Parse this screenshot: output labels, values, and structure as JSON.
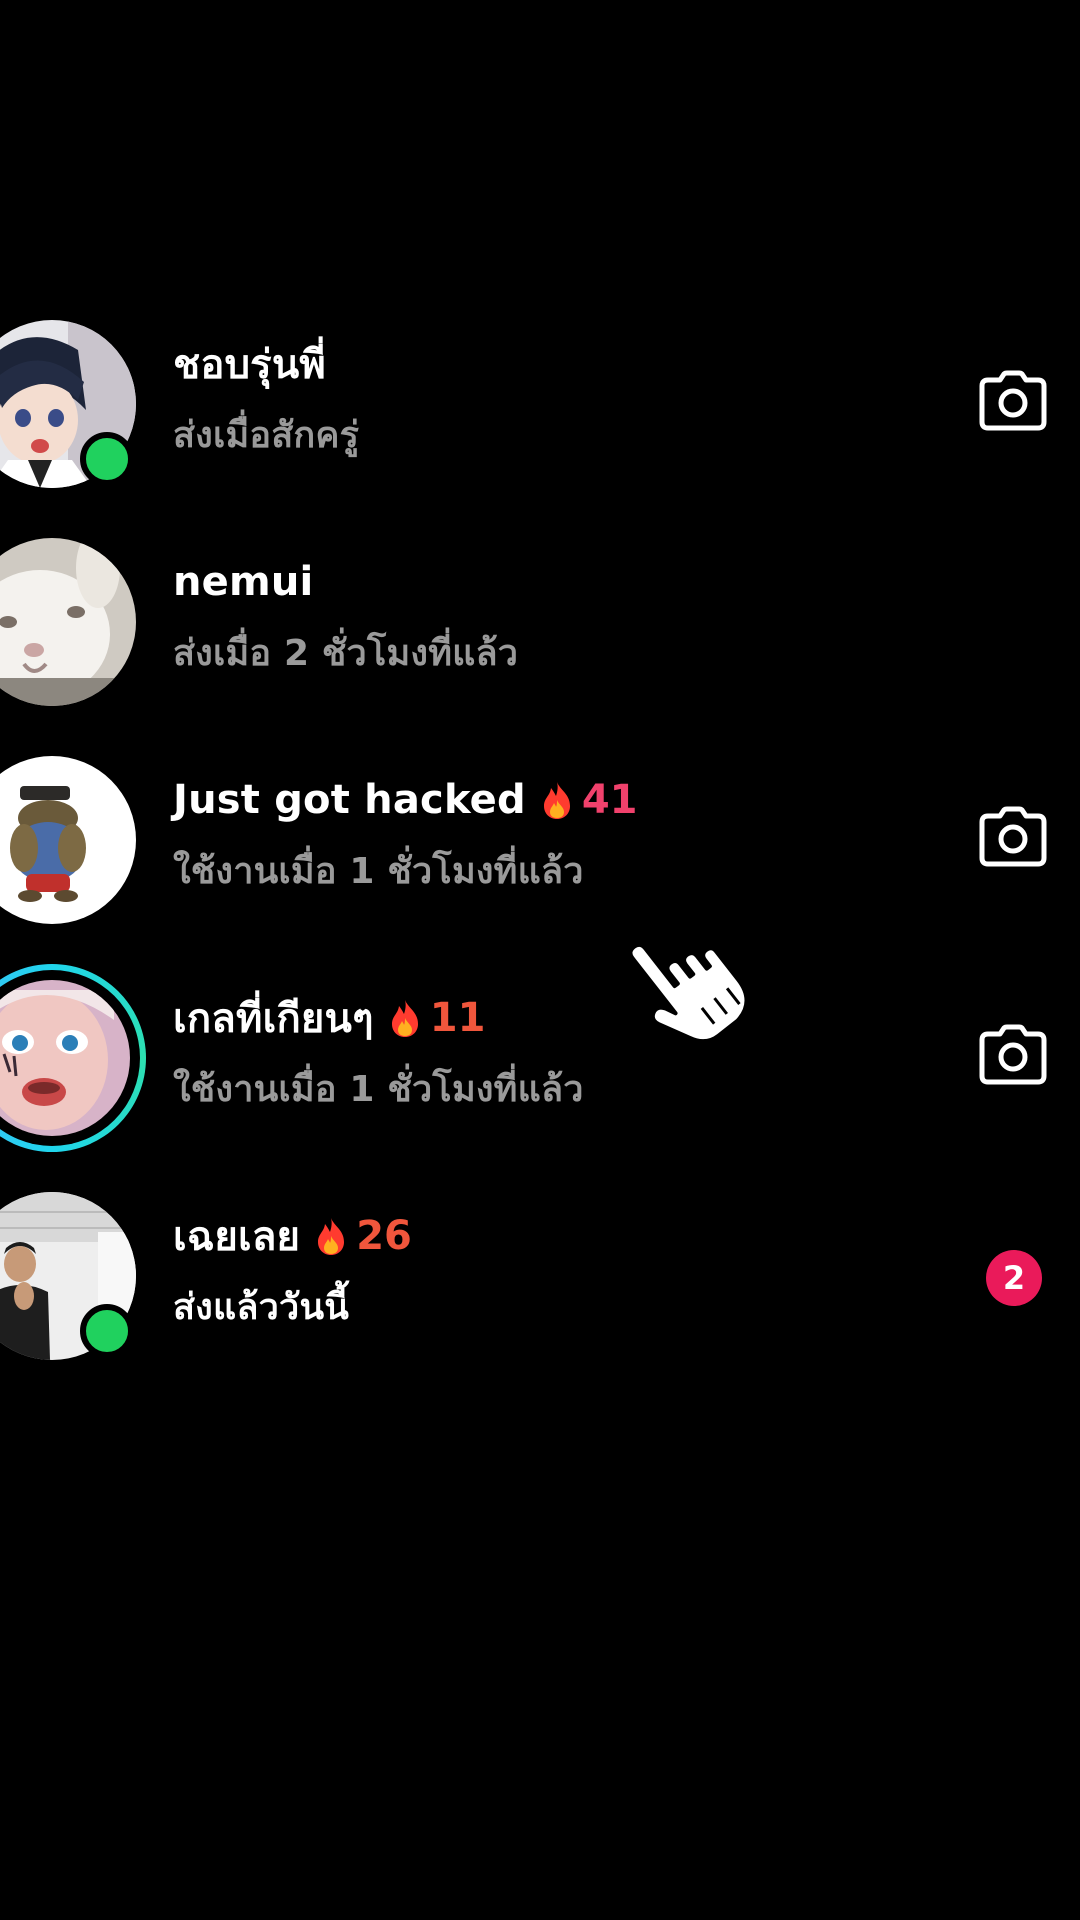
{
  "chats": [
    {
      "name": "ชอบรุ่นพี่",
      "status": "ส่งเมื่อสักครู่",
      "streak": null,
      "online": true,
      "story_ring": false,
      "avatar_icon": "anime-boy-avatar",
      "action": "camera"
    },
    {
      "name": "nemui",
      "status": "ส่งเมื่อ 2 ชั่วโมงที่แล้ว",
      "streak": null,
      "online": false,
      "story_ring": false,
      "avatar_icon": "white-rabbit-avatar",
      "action": null
    },
    {
      "name": "Just got hacked",
      "status": "ใช้งานเมื่อ 1 ชั่วโมงที่แล้ว",
      "streak": "41",
      "streak_color": "#f0416c",
      "online": false,
      "story_ring": false,
      "avatar_icon": "frog-figure-avatar",
      "action": "camera"
    },
    {
      "name": "เกลที่เกียนๆ",
      "status": "ใช้งานเมื่อ 1 ชั่วโมงที่แล้ว",
      "streak": "11",
      "streak_color": "#f0563c",
      "online": false,
      "story_ring": true,
      "avatar_icon": "doll-face-avatar",
      "action": "camera"
    },
    {
      "name": "เฉยเลย",
      "status": "ส่งแล้ววันนี้",
      "status_bright": true,
      "streak": "26",
      "streak_color": "#f0563c",
      "online": true,
      "story_ring": false,
      "avatar_icon": "person-photo-avatar",
      "action": "badge",
      "badge": "2"
    }
  ],
  "colors": {
    "background": "#000000",
    "online": "#20d15e",
    "badge": "#ea1a5a",
    "story_ring": "#20d5ec",
    "secondary_text": "#9a9a9a"
  },
  "overlay": {
    "icon": "hand-pointer-icon"
  }
}
